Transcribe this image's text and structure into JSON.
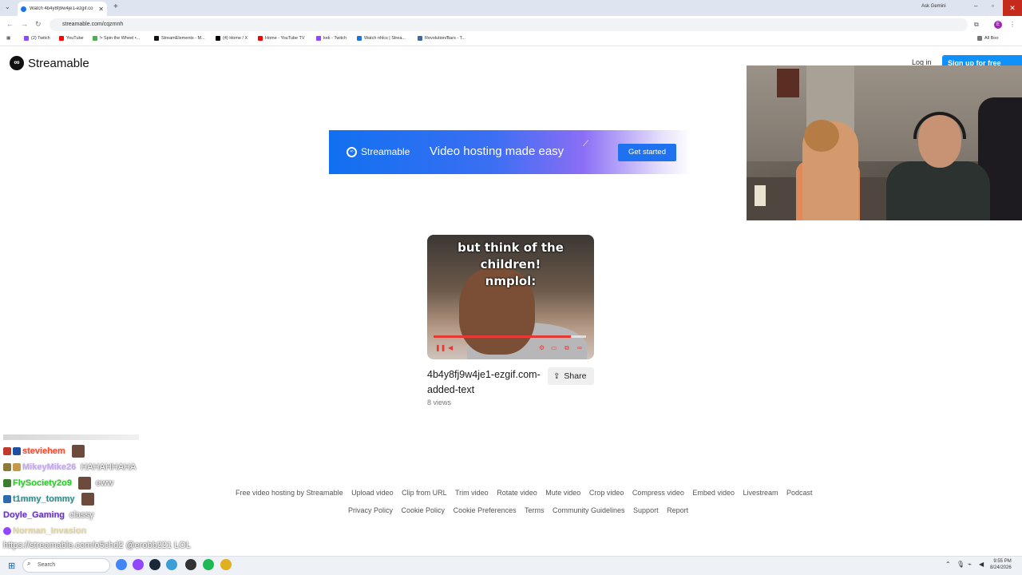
{
  "browser": {
    "tab_title": "Watch 4b4y8fj9w4je1-ezgif.co",
    "ask_gemini": "Ask Gemini",
    "url": "streamable.com/cqzmnh",
    "profile_initial": "E",
    "bookmarks": [
      {
        "label": "(2) Twitch",
        "color": "#9146ff"
      },
      {
        "label": "YouTube",
        "color": "#ff0000"
      },
      {
        "label": "!• Spin the Wheel •...",
        "color": "#4caf50"
      },
      {
        "label": "StreamElements - M...",
        "color": "#111111"
      },
      {
        "label": "(4) Home / X",
        "color": "#000000"
      },
      {
        "label": "Home - YouTube TV",
        "color": "#ff0000"
      },
      {
        "label": "kek - Twitch",
        "color": "#9146ff"
      },
      {
        "label": "Watch nhlcs | Strea...",
        "color": "#1b74e4"
      },
      {
        "label": "Revolution/Bars - T...",
        "color": "#3f6aa0"
      }
    ],
    "all_bookmarks": "All Boo"
  },
  "header": {
    "logo": "Streamable",
    "login": "Log in",
    "signup": "Sign up for free"
  },
  "ad": {
    "logo": "Streamable",
    "tagline": "Video hosting made easy",
    "cta": "Get started"
  },
  "video": {
    "caption_line1": "but think of the children!",
    "caption_line2": "nmplol:",
    "progress_fraction": 0.9,
    "title": "4b4y8fj9w4je1-ezgif.com-added-text",
    "views": "8 views",
    "share": "Share"
  },
  "footer": {
    "row1": [
      "Free video hosting by Streamable",
      "Upload video",
      "Clip from URL",
      "Trim video",
      "Rotate video",
      "Mute video",
      "Crop video",
      "Compress video",
      "Embed video",
      "Livestream",
      "Podcast"
    ],
    "row2": [
      "Privacy Policy",
      "Cookie Policy",
      "Cookie Preferences",
      "Terms",
      "Community Guidelines",
      "Support",
      "Report"
    ]
  },
  "chat": {
    "lines": [
      {
        "user": "steviehem",
        "color": "#ff4a2a",
        "message": "",
        "emote": true
      },
      {
        "user": "MikeyMike26",
        "color": "#c9a6f5",
        "message": "HAHAHHAHA",
        "emote": false
      },
      {
        "user": "FlySociety2o9",
        "color": "#28d128",
        "message": "eww",
        "emote": true
      },
      {
        "user": "t1mmy_tommy",
        "color": "#2f8f8f",
        "message": "",
        "emote": true
      },
      {
        "user": "Doyle_Gaming",
        "color": "#6a2fd4",
        "message": "classy",
        "emote": false
      },
      {
        "user": "Norman_Invasion",
        "color": "#e3d6a2",
        "message": "",
        "emote": false
      }
    ],
    "url_line": "https://streamable.com/o5chd2 @erobb221 LOL"
  },
  "taskbar": {
    "search": "Search",
    "time": "9:55 PM",
    "date": "8/24/2026"
  }
}
